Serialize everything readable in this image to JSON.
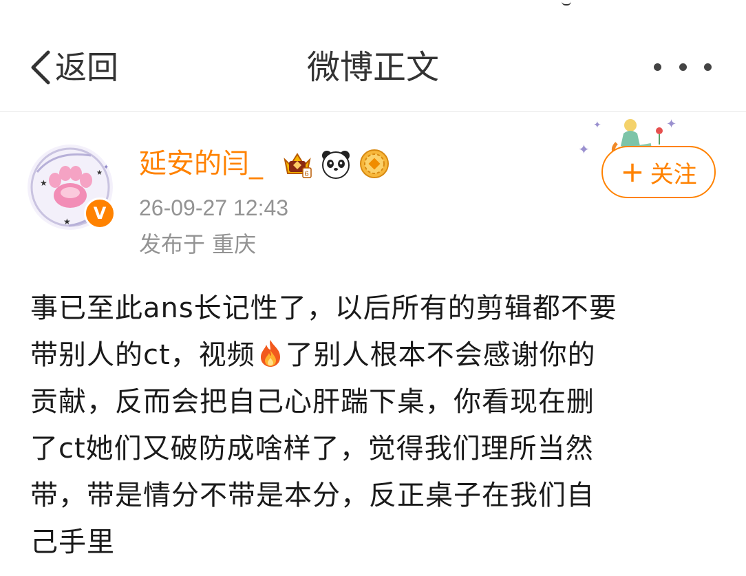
{
  "nav": {
    "back_label": "返回",
    "title": "微博正文",
    "more_icon": "more-dots-icon"
  },
  "author": {
    "name": "延安的闫_",
    "verified_mark": "V",
    "badges": [
      "crown-level-icon",
      "panda-icon",
      "gold-coin-icon"
    ],
    "timestamp": "26-09-27 12:43",
    "location": "发布于 重庆"
  },
  "follow_button": {
    "plus": "+",
    "label": "关注"
  },
  "post": {
    "line1": "事已至此ans长记性了，以后所有的剪辑都不要",
    "line2_a": "带别人的ct，视频",
    "line2_emoji": "fire-emoji-icon",
    "line2_b": "了别人根本不会感谢你的",
    "line3": "贡献，反而会把自己心肝踹下桌，你看现在删",
    "line4": "了ct她们又破防成啥样了，觉得我们理所当然",
    "line5": "带，带是情分不带是本分，反正桌子在我们自",
    "line6": "己手里"
  },
  "colors": {
    "accent": "#ff8200",
    "secondary_text": "#939393",
    "primary_text": "#1a1a1a"
  }
}
